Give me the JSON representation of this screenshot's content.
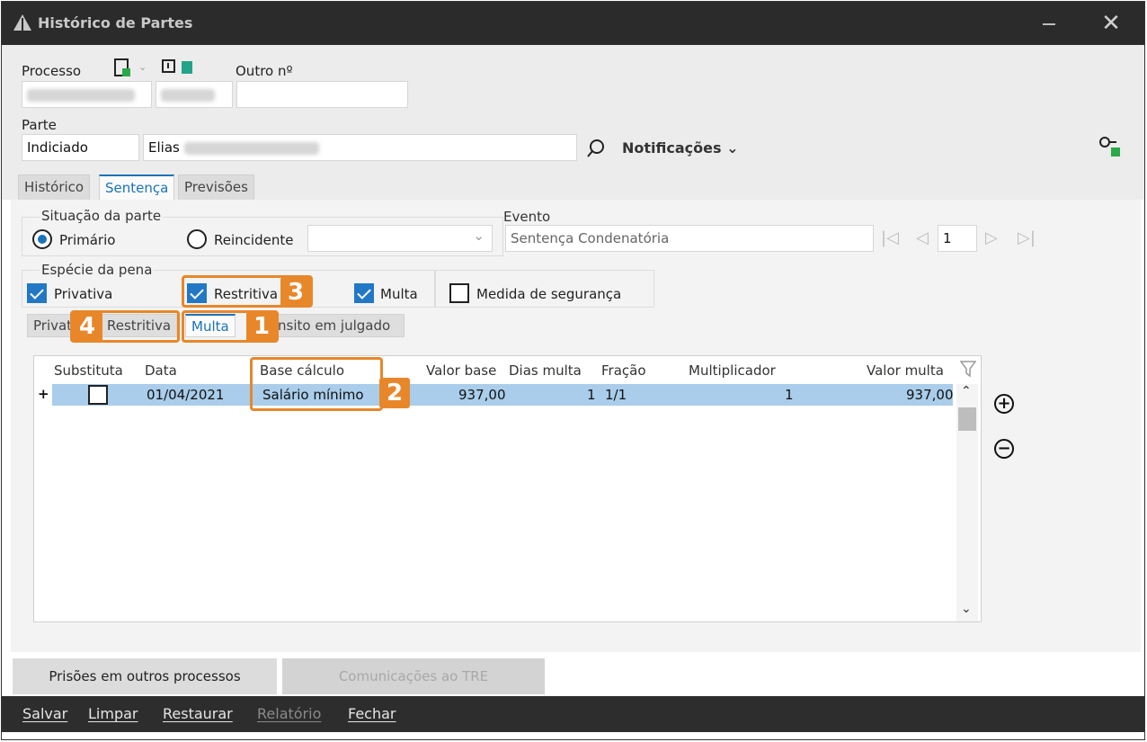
{
  "window": {
    "title": "Histórico de Partes"
  },
  "header": {
    "processo_label": "Processo",
    "outro_label": "Outro nº",
    "parte_label": "Parte",
    "parte_tipo": "Indiciado",
    "parte_nome": "Elias",
    "notificacoes_label": "Notificações"
  },
  "tabs": [
    "Histórico",
    "Sentença",
    "Previsões"
  ],
  "situacao": {
    "label": "Situação da parte",
    "primario": "Primário",
    "reincidente": "Reincidente"
  },
  "evento": {
    "label": "Evento",
    "value": "Sentença Condenatória",
    "page": "1"
  },
  "especie": {
    "label": "Espécie da pena",
    "privativa": "Privativa",
    "restritiva": "Restritiva",
    "multa": "Multa",
    "medida": "Medida de segurança"
  },
  "subtabs": [
    "Privat",
    "Restritiva",
    "Multa",
    "nsito em julgado"
  ],
  "grid": {
    "columns": [
      "Substituta",
      "Data",
      "Base cálculo",
      "Valor base",
      "Dias multa",
      "Fração",
      "Multiplicador",
      "Valor multa"
    ],
    "rows": [
      {
        "expand": "+",
        "data": "01/04/2021",
        "base": "Salário mínimo",
        "valor_base": "937,00",
        "dias": "1",
        "fracao": "1/1",
        "mult": "1",
        "valor_multa": "937,00"
      }
    ]
  },
  "callouts": [
    "1",
    "2",
    "3",
    "4"
  ],
  "buttons": {
    "prisoes": "Prisões em outros processos",
    "comunicacoes": "Comunicações ao TRE"
  },
  "footer": [
    "Salvar",
    "Limpar",
    "Restaurar",
    "Relatório",
    "Fechar"
  ]
}
